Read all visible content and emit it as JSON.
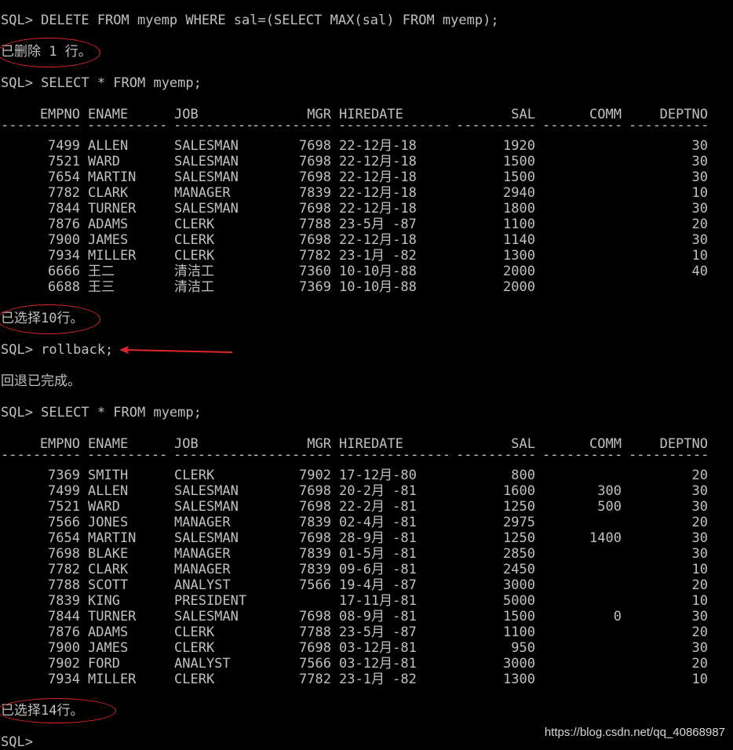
{
  "prompt": "SQL>",
  "cmd_delete": "SQL> DELETE FROM myemp WHERE sal=(SELECT MAX(sal) FROM myemp);",
  "msg_deleted": "已删除 1 行。",
  "cmd_select_1": "SQL> SELECT * FROM myemp;",
  "columns": [
    "EMPNO",
    "ENAME",
    "JOB",
    "MGR",
    "HIREDATE",
    "SAL",
    "COMM",
    "DEPTNO"
  ],
  "table1_rows": [
    [
      "7499",
      "ALLEN",
      "SALESMAN",
      "7698",
      "22-12月-18",
      "1920",
      "",
      "30"
    ],
    [
      "7521",
      "WARD",
      "SALESMAN",
      "7698",
      "22-12月-18",
      "1500",
      "",
      "30"
    ],
    [
      "7654",
      "MARTIN",
      "SALESMAN",
      "7698",
      "22-12月-18",
      "1500",
      "",
      "30"
    ],
    [
      "7782",
      "CLARK",
      "MANAGER",
      "7839",
      "22-12月-18",
      "2940",
      "",
      "10"
    ],
    [
      "7844",
      "TURNER",
      "SALESMAN",
      "7698",
      "22-12月-18",
      "1800",
      "",
      "30"
    ],
    [
      "7876",
      "ADAMS",
      "CLERK",
      "7788",
      "23-5月 -87",
      "1100",
      "",
      "20"
    ],
    [
      "7900",
      "JAMES",
      "CLERK",
      "7698",
      "22-12月-18",
      "1140",
      "",
      "30"
    ],
    [
      "7934",
      "MILLER",
      "CLERK",
      "7782",
      "23-1月 -82",
      "1300",
      "",
      "10"
    ],
    [
      "6666",
      "王二",
      "清洁工",
      "7360",
      "10-10月-88",
      "2000",
      "",
      "40"
    ],
    [
      "6688",
      "王三",
      "清洁工",
      "7369",
      "10-10月-88",
      "2000",
      "",
      ""
    ]
  ],
  "msg_selected_10": "已选择10行。",
  "cmd_rollback": "SQL> rollback;",
  "msg_rollback_done": "回退已完成。",
  "cmd_select_2": "SQL> SELECT * FROM myemp;",
  "table2_rows": [
    [
      "7369",
      "SMITH",
      "CLERK",
      "7902",
      "17-12月-80",
      "800",
      "",
      "20"
    ],
    [
      "7499",
      "ALLEN",
      "SALESMAN",
      "7698",
      "20-2月 -81",
      "1600",
      "300",
      "30"
    ],
    [
      "7521",
      "WARD",
      "SALESMAN",
      "7698",
      "22-2月 -81",
      "1250",
      "500",
      "30"
    ],
    [
      "7566",
      "JONES",
      "MANAGER",
      "7839",
      "02-4月 -81",
      "2975",
      "",
      "20"
    ],
    [
      "7654",
      "MARTIN",
      "SALESMAN",
      "7698",
      "28-9月 -81",
      "1250",
      "1400",
      "30"
    ],
    [
      "7698",
      "BLAKE",
      "MANAGER",
      "7839",
      "01-5月 -81",
      "2850",
      "",
      "30"
    ],
    [
      "7782",
      "CLARK",
      "MANAGER",
      "7839",
      "09-6月 -81",
      "2450",
      "",
      "10"
    ],
    [
      "7788",
      "SCOTT",
      "ANALYST",
      "7566",
      "19-4月 -87",
      "3000",
      "",
      "20"
    ],
    [
      "7839",
      "KING",
      "PRESIDENT",
      "",
      "17-11月-81",
      "5000",
      "",
      "10"
    ],
    [
      "7844",
      "TURNER",
      "SALESMAN",
      "7698",
      "08-9月 -81",
      "1500",
      "0",
      "30"
    ],
    [
      "7876",
      "ADAMS",
      "CLERK",
      "7788",
      "23-5月 -87",
      "1100",
      "",
      "20"
    ],
    [
      "7900",
      "JAMES",
      "CLERK",
      "7698",
      "03-12月-81",
      "950",
      "",
      "30"
    ],
    [
      "7902",
      "FORD",
      "ANALYST",
      "7566",
      "03-12月-81",
      "3000",
      "",
      "20"
    ],
    [
      "7934",
      "MILLER",
      "CLERK",
      "7782",
      "23-1月 -82",
      "1300",
      "",
      "10"
    ]
  ],
  "msg_selected_14": "已选择14行。",
  "final_prompt": "SQL>",
  "watermark": "https://blog.csdn.net/qq_40868987",
  "colors": {
    "background": "#000000",
    "text": "#c0c0c0",
    "annotation_red": "#e0262a"
  }
}
